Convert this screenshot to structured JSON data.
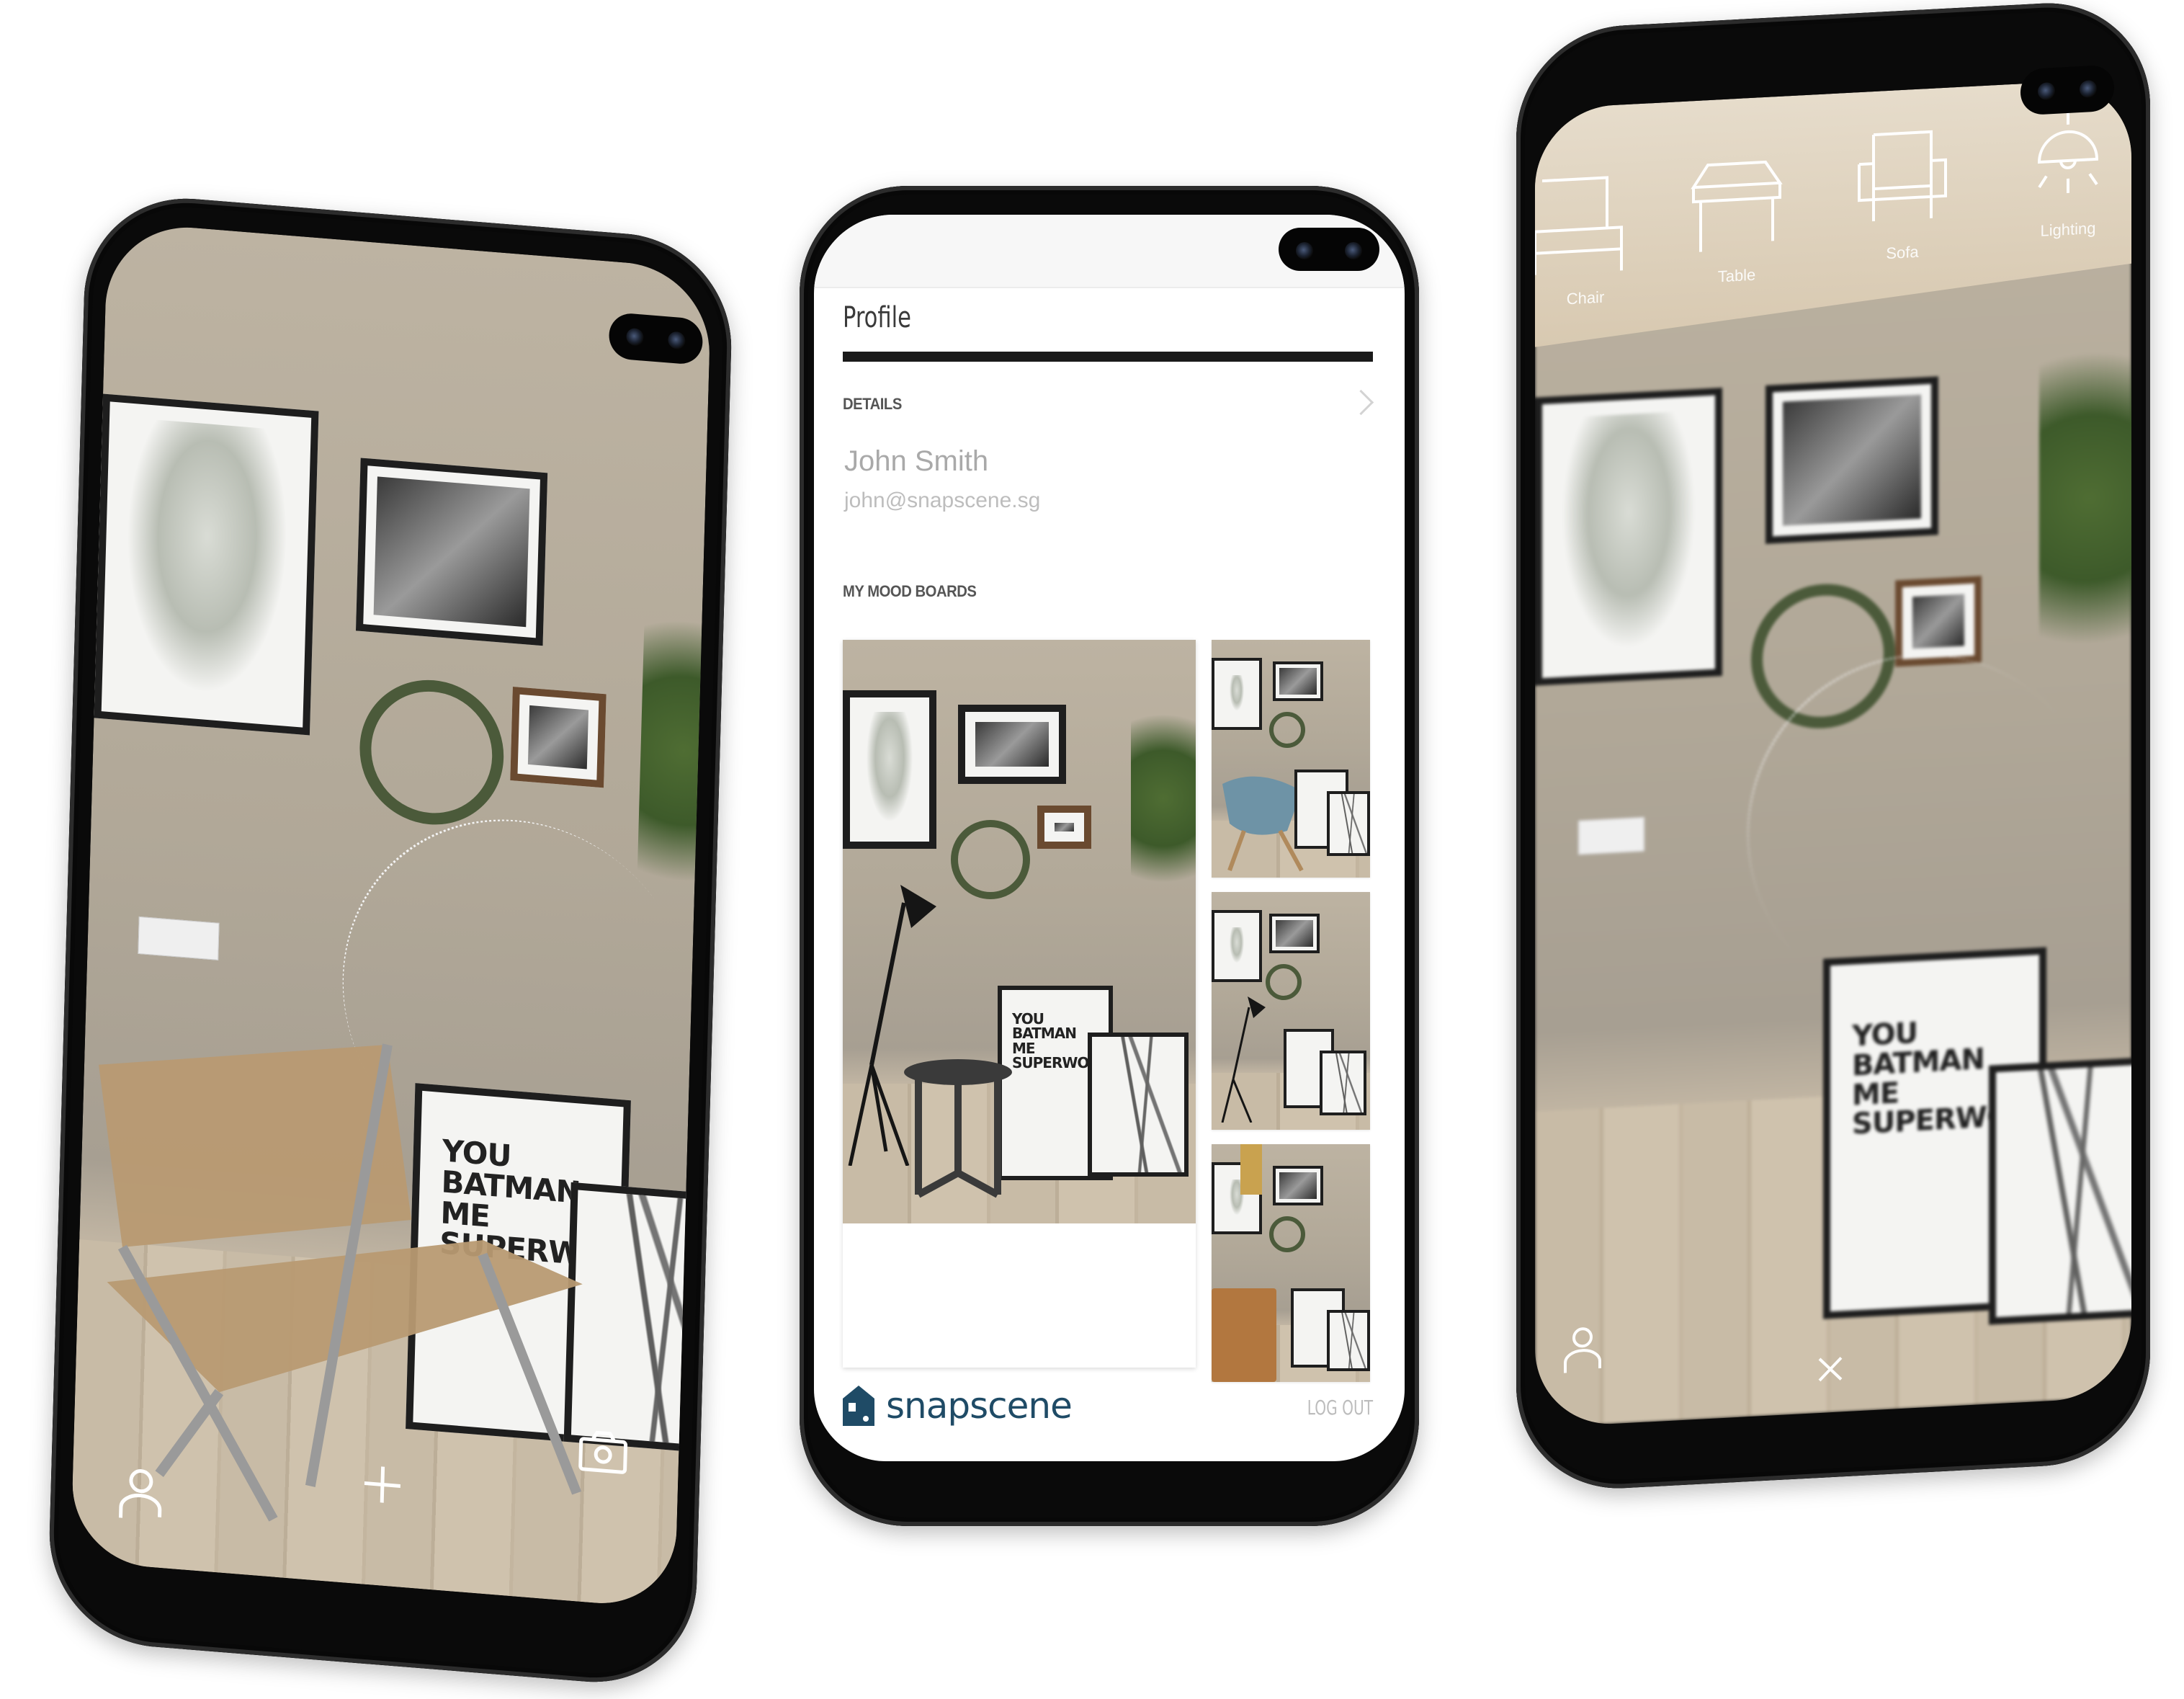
{
  "left_phone": {
    "screen": "ar-camera-view",
    "placed_item": "folding rattan chair",
    "poster_text": [
      "YOU",
      "BATMAN",
      "ME",
      "SUPERWOM"
    ],
    "bottom_bar": {
      "profile_icon": "person-icon",
      "add_icon": "plus-icon",
      "camera_icon": "camera-icon"
    }
  },
  "center_phone": {
    "screen": "profile",
    "header": {
      "title": "Profile"
    },
    "details": {
      "section_label": "DETAILS",
      "name": "John Smith",
      "email": "john@snapscene.sg"
    },
    "mood_boards": {
      "section_label": "MY MOOD BOARDS",
      "boards": [
        {
          "name": "mood-board-floor-lamp-side-table",
          "poster_text": [
            "YOU",
            "BATMAN",
            "ME",
            "SUPERWON"
          ]
        },
        {
          "name": "mood-board-blue-rocking-chair"
        },
        {
          "name": "mood-board-lamp-table-small"
        },
        {
          "name": "mood-board-tan-chair-pendant"
        }
      ]
    },
    "footer": {
      "brand": "snapscene",
      "logout_label": "LOG OUT"
    },
    "colors": {
      "brand": "#1f4b66",
      "title_bar": "#1a1a1a",
      "muted_text": "#a9a9a9"
    }
  },
  "right_phone": {
    "screen": "ar-category-picker",
    "categories": [
      {
        "label": "Chair",
        "icon": "chair-icon"
      },
      {
        "label": "Table",
        "icon": "table-icon"
      },
      {
        "label": "Sofa",
        "icon": "sofa-icon"
      },
      {
        "label": "Lighting",
        "icon": "lamp-icon"
      }
    ],
    "poster_text": [
      "YOU",
      "BATMAN",
      "ME",
      "SUPERWON"
    ],
    "bottom_bar": {
      "profile_icon": "person-icon",
      "close_icon": "close-icon"
    }
  }
}
